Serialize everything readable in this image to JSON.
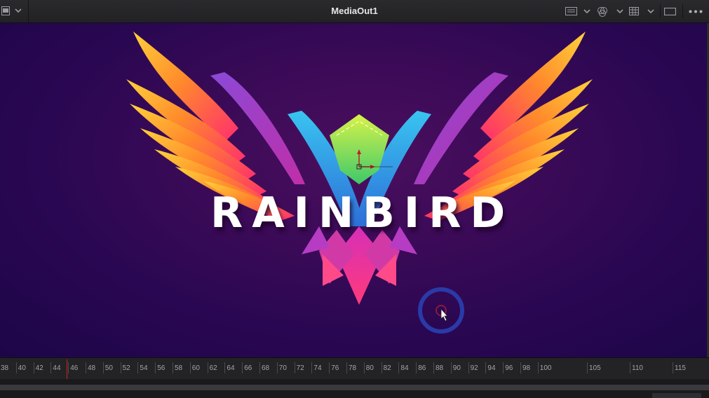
{
  "toolbar": {
    "viewer_title": "MediaOut1",
    "left_icons": [
      "viewer-layout-icon",
      "chevron-down-icon"
    ],
    "right_icons": [
      "display-mode-icon",
      "chevron-down-icon",
      "color-channel-icon",
      "chevron-down-icon",
      "grid-icon",
      "chevron-down-icon",
      "frame-icon",
      "more-options-icon"
    ]
  },
  "viewer": {
    "logo_text": "RAINBIRD",
    "background_color": "#3a0a57",
    "cursor_icon": "pointer-cursor-icon"
  },
  "timeline": {
    "ticks": [
      "38",
      "40",
      "42",
      "44",
      "46",
      "48",
      "50",
      "52",
      "54",
      "56",
      "58",
      "60",
      "62",
      "64",
      "66",
      "68",
      "70",
      "72",
      "74",
      "76",
      "78",
      "80",
      "82",
      "84",
      "86",
      "88",
      "90",
      "92",
      "94",
      "96",
      "98",
      "100",
      "105",
      "110",
      "115"
    ],
    "playhead_color": "#d02020"
  }
}
